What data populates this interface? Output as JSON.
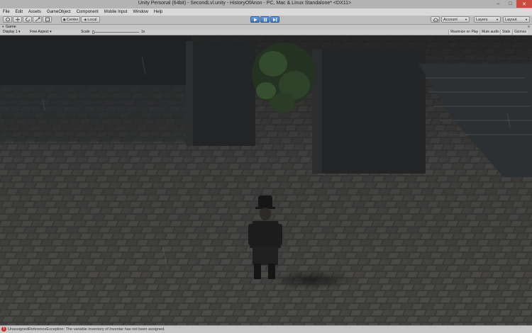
{
  "window": {
    "title": "Unity Personal (64bit) - SecondLvl.unity - HistoryOfAnon - PC, Mac & Linux Standalone* <DX11>",
    "controls": [
      "–",
      "□",
      "✕"
    ]
  },
  "menu": [
    "File",
    "Edit",
    "Assets",
    "GameObject",
    "Component",
    "Mobile Input",
    "Window",
    "Help"
  ],
  "toolbar": {
    "center_label": "Center",
    "local_label": "Local",
    "account_label": "Account",
    "layers_label": "Layers",
    "layout_label": "Layout"
  },
  "game_view": {
    "tab_label": "Game",
    "display_label": "Display 1",
    "aspect_label": "Free Aspect",
    "scale_label": "Scale",
    "scale_value": "1x",
    "maximize_label": "Maximize on Play",
    "mute_label": "Mute audio",
    "stats_label": "Stats",
    "gizmos_label": "Gizmos"
  },
  "status": {
    "message": "UnassignedReferenceException: The variable inventory of Inventar has not been assigned."
  },
  "colors": {
    "play_active": "#3c72c0",
    "error": "#c8302a"
  }
}
